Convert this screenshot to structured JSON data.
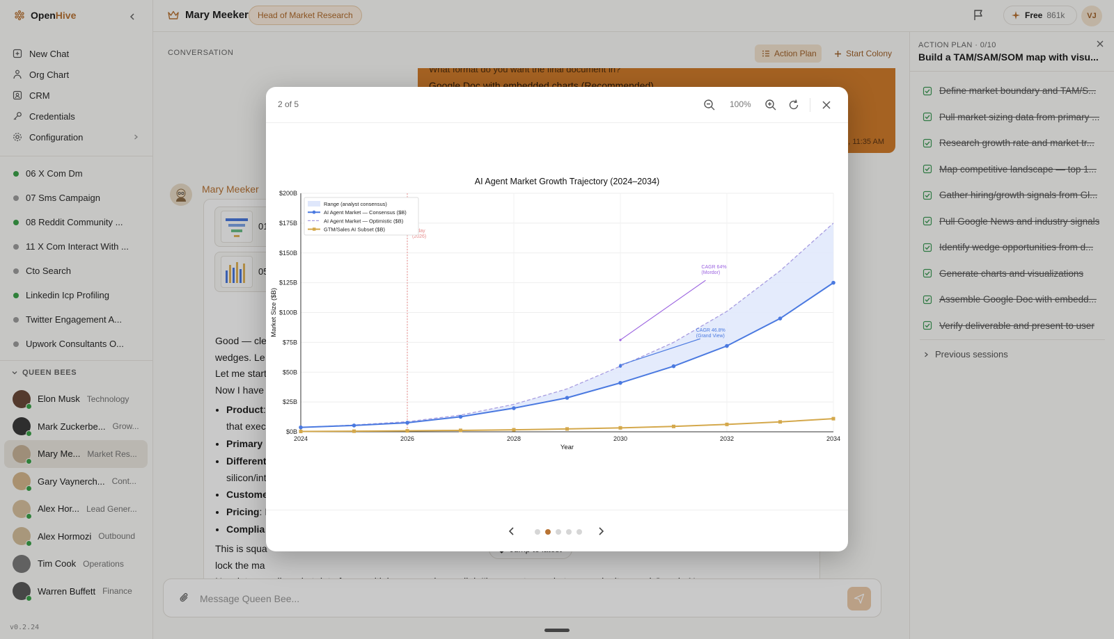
{
  "brand": {
    "open": "Open",
    "hive": "Hive"
  },
  "nav": [
    {
      "label": "New Chat",
      "icon": "new-chat-icon"
    },
    {
      "label": "Org Chart",
      "icon": "org-chart-icon"
    },
    {
      "label": "CRM",
      "icon": "crm-icon"
    },
    {
      "label": "Credentials",
      "icon": "key-icon"
    },
    {
      "label": "Configuration",
      "icon": "gear-icon"
    }
  ],
  "colonies": [
    {
      "label": "06 X Com Dm",
      "color": "#3ca34a"
    },
    {
      "label": "07 Sms Campaign",
      "color": "#9e9e9e"
    },
    {
      "label": "08 Reddit Community ...",
      "color": "#3ca34a"
    },
    {
      "label": "11 X Com Interact With ...",
      "color": "#9e9e9e"
    },
    {
      "label": "Cto Search",
      "color": "#9e9e9e"
    },
    {
      "label": "Linkedin Icp Profiling",
      "color": "#3ca34a"
    },
    {
      "label": "Twitter Engagement A...",
      "color": "#9e9e9e"
    },
    {
      "label": "Upwork Consultants O...",
      "color": "#9e9e9e"
    }
  ],
  "queen_bees_title": "QUEEN BEES",
  "bees": [
    {
      "name": "Elon Musk",
      "role": "Technology",
      "color": "#6b4a3a"
    },
    {
      "name": "Mark Zuckerbe...",
      "role": "Grow...",
      "color": "#3b3b3b"
    },
    {
      "name": "Mary Me...",
      "role": "Market Res...",
      "color": "#c9b49a",
      "active": true
    },
    {
      "name": "Gary Vaynerch...",
      "role": "Cont...",
      "color": "#d7b98f"
    },
    {
      "name": "Alex Hor...",
      "role": "Lead Gener...",
      "color": "#d9c3a0"
    },
    {
      "name": "Alex Hormozi",
      "role": "Outbound",
      "color": "#d6c09d"
    },
    {
      "name": "Tim Cook",
      "role": "Operations",
      "color": "#7c7c7c"
    },
    {
      "name": "Warren Buffett",
      "role": "Finance",
      "color": "#5b5b5b"
    }
  ],
  "version": "v0.2.24",
  "topbar": {
    "name": "Mary Meeker",
    "role": "Head of Market Research",
    "plan": "Free",
    "credits": "861k",
    "user_initials": "VJ"
  },
  "conversation": {
    "label": "CONVERSATION",
    "action_plan_btn": "Action Plan",
    "start_colony_btn": "Start Colony",
    "user_msg_line1": "What format do you want the final document in?",
    "user_msg_line2": "Google Doc with embedded charts (Recommended)",
    "user_msg_time": "4, 11:35 AM",
    "agent_name": "Mary Meeker",
    "attachments": [
      {
        "name": "01"
      },
      {
        "name": "05"
      }
    ],
    "lines": [
      "Good — cle",
      "wedges. Le",
      "Let me start",
      "Now I have"
    ],
    "bullets": [
      {
        "bold": "Product",
        "rest": ":"
      },
      {
        "bold": "",
        "rest": "that exec"
      },
      {
        "bold": "Primary",
        "rest": ""
      },
      {
        "bold": "Differenti",
        "rest": ""
      },
      {
        "bold": "",
        "rest": "silicon/int"
      },
      {
        "bold": "Custome",
        "rest": ""
      },
      {
        "bold": "Pricing",
        "rest": ": I"
      },
      {
        "bold": "Complia",
        "rest": ""
      }
    ],
    "tail_lines": [
      "This is squa",
      "lock the ma",
      "Now let me pull market data from multiple sources in parallel. I'l          orts, market research sites, and Google News",
      "simultaneously"
    ],
    "jump_label": "Jump to latest",
    "composer_placeholder": "Message Queen Bee..."
  },
  "action_plan": {
    "label": "ACTION PLAN · 0/10",
    "title": "Build a TAM/SAM/SOM map with visu...",
    "steps": [
      "Define market boundary and TAM/S...",
      "Pull market sizing data from primary ...",
      "Research growth rate and market tr...",
      "Map competitive landscape — top 1...",
      "Gather hiring/growth signals from Gl...",
      "Pull Google News and industry signals",
      "Identify wedge opportunities from d...",
      "Generate charts and visualizations",
      "Assemble Google Doc with embedd...",
      "Verify deliverable and present to user"
    ],
    "previous_sessions": "Previous sessions"
  },
  "viewer": {
    "counter": "2 of 5",
    "zoom": "100%",
    "total_pages": 5,
    "current_page": 2
  },
  "chart_data": {
    "type": "line",
    "title": "AI Agent Market Growth Trajectory (2024–2034)",
    "xlabel": "Year",
    "ylabel": "Market Size ($B)",
    "x": [
      2024,
      2025,
      2026,
      2027,
      2028,
      2029,
      2030,
      2031,
      2032,
      2033,
      2034
    ],
    "xlim": [
      2024,
      2034
    ],
    "ylim": [
      0,
      200
    ],
    "xticks": [
      "2024",
      "2026",
      "2028",
      "2030",
      "2032",
      "2034"
    ],
    "yticks": [
      "$0B",
      "$25B",
      "$50B",
      "$75B",
      "$100B",
      "$125B",
      "$150B",
      "$175B",
      "$200B"
    ],
    "legend_position": "top-left",
    "band_label": "Range (analyst consensus)",
    "series": [
      {
        "name": "AI Agent Market — Consensus ($B)",
        "style": "solid-marker",
        "color": "#4a79e0",
        "values": [
          3.7,
          5.3,
          7.6,
          12.6,
          19.8,
          28.5,
          41.0,
          55.0,
          72.0,
          95.0,
          125.0
        ]
      },
      {
        "name": "AI Agent Market — Optimistic ($B)",
        "style": "dashed",
        "color": "#a79ce0",
        "values": [
          3.7,
          5.7,
          8.5,
          14.0,
          23.0,
          36.0,
          55.0,
          75.0,
          101.0,
          135.0,
          175.0
        ]
      },
      {
        "name": "GTM/Sales AI Subset ($B)",
        "style": "solid-marker",
        "color": "#d4a84b",
        "values": [
          0.3,
          0.5,
          0.8,
          1.2,
          1.7,
          2.4,
          3.3,
          4.5,
          6.2,
          8.3,
          11.0
        ]
      }
    ],
    "annotations": [
      {
        "text": "Today (2026)",
        "x": 2026,
        "color": "#e58a8a"
      },
      {
        "line1": "CAGR 64%",
        "line2": "(Mordor)",
        "color": "#9b63e0",
        "from": [
          2030,
          77
        ],
        "to": [
          2031.6,
          127
        ]
      },
      {
        "line1": "CAGR 46.8%",
        "line2": "(Grand View)",
        "color": "#4a79e0",
        "from": [
          2030,
          56
        ],
        "to": [
          2031.5,
          78
        ]
      }
    ]
  }
}
